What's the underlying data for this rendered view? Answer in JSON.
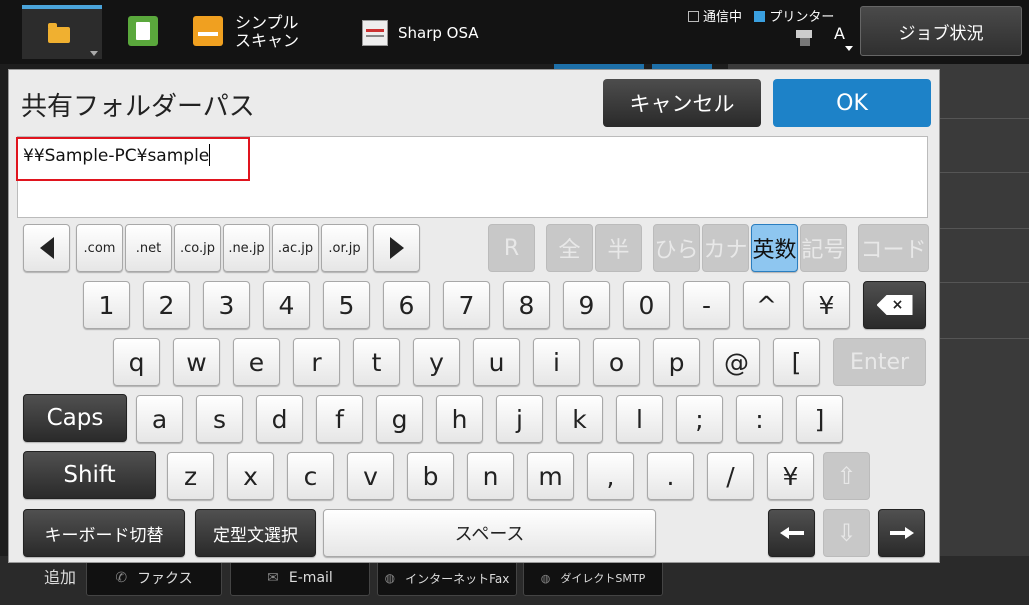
{
  "topbar": {
    "tab_simple_scan": "シンプル\nスキャン",
    "tab_simple_scan_line1": "シンプル",
    "tab_simple_scan_line2": "スキャン",
    "tab_sharp_osa": "Sharp OSA",
    "status_comm": "通信中",
    "status_printer": "プリンター",
    "job_status_button": "ジョブ状況",
    "font_indicator": "A"
  },
  "dialog": {
    "title": "共有フォルダーパス",
    "cancel": "キャンセル",
    "ok": "OK",
    "input_value": "¥¥Sample-PC¥sample"
  },
  "keyboard": {
    "domains": [
      ".com",
      ".net",
      ".co.jp",
      ".ne.jp",
      ".ac.jp",
      ".or.jp"
    ],
    "modes": [
      "R",
      "全",
      "半",
      "ひら",
      "カナ",
      "英数",
      "記号",
      "コード"
    ],
    "selected_mode": "英数",
    "row1": [
      "1",
      "2",
      "3",
      "4",
      "5",
      "6",
      "7",
      "8",
      "9",
      "0",
      "-",
      "^",
      "¥"
    ],
    "row2": [
      "q",
      "w",
      "e",
      "r",
      "t",
      "y",
      "u",
      "i",
      "o",
      "p",
      "@",
      "["
    ],
    "row3": [
      "a",
      "s",
      "d",
      "f",
      "g",
      "h",
      "j",
      "k",
      "l",
      ";",
      ":",
      "]"
    ],
    "row4": [
      "z",
      "x",
      "c",
      "v",
      "b",
      "n",
      "m",
      ",",
      ".",
      "/",
      "¥"
    ],
    "backspace": "×",
    "enter": "Enter",
    "caps": "Caps",
    "shift": "Shift",
    "keyboard_switch": "キーボード切替",
    "template_select": "定型文選択",
    "space": "スペース"
  },
  "bottom": {
    "add_label": "追加",
    "fax": "ファクス",
    "email": "E-mail",
    "internet_fax": "インターネットFax",
    "direct_smtp": "ダイレクトSMTP"
  },
  "colors": {
    "accent_blue": "#1d82c8",
    "highlight_red": "#e0141e",
    "selected_mode": "#8ec6f0"
  },
  "icons": [
    "folder-icon",
    "copy-icon",
    "scan-icon",
    "osa-icon",
    "printer-status-icon",
    "backspace-icon",
    "up-arrow-icon",
    "down-arrow-icon",
    "left-arrow-icon",
    "right-arrow-icon",
    "phone-icon",
    "mail-icon",
    "globe-icon"
  ]
}
